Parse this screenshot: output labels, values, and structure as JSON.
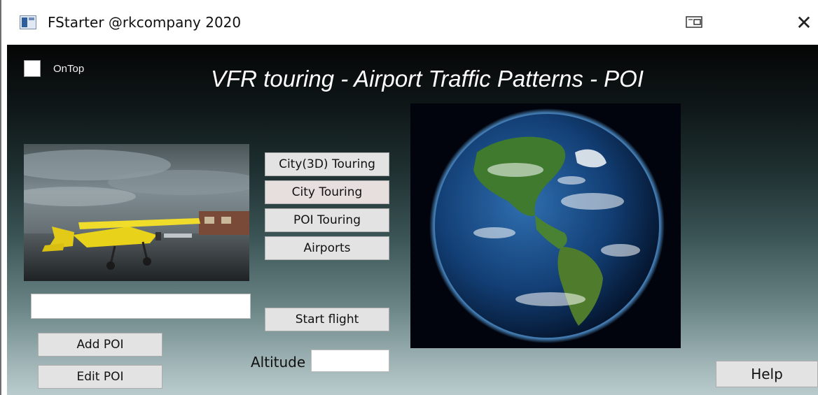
{
  "window": {
    "title": "FStarter @rkcompany 2020",
    "close_glyph": "✕",
    "icons": [
      "app-icon",
      "restore-icon",
      "close-icon"
    ]
  },
  "options": {
    "ontop_label": "OnTop",
    "ontop_checked": false
  },
  "header": {
    "title": "VFR touring - Airport Traffic Patterns - POI"
  },
  "menu": {
    "city3d_label": "City(3D) Touring",
    "city_label": "City Touring",
    "poi_label": "POI Touring",
    "airports_label": "Airports"
  },
  "flight": {
    "start_label": "Start flight",
    "altitude_label": "Altitude",
    "altitude_value": ""
  },
  "poi": {
    "input_value": "",
    "add_label": "Add POI",
    "edit_label": "Edit POI"
  },
  "help": {
    "label": "Help"
  },
  "colors": {
    "button_face": "#e3e3e3",
    "button_border": "#adadad",
    "background_top": "#050606",
    "background_bottom": "#b9cbcd",
    "plane": "#e8d21a"
  }
}
